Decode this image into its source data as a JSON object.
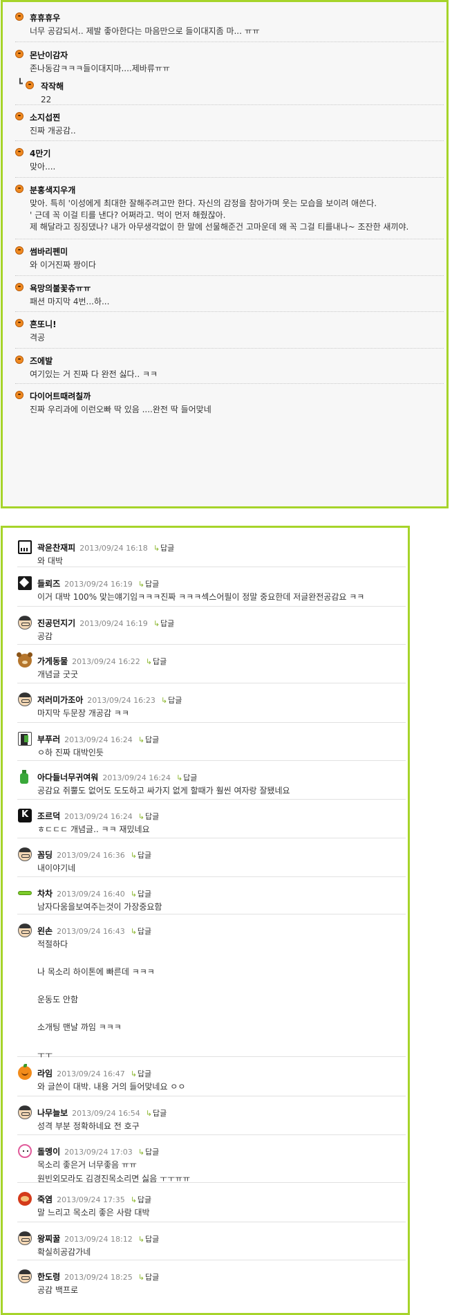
{
  "panel1": {
    "comments": [
      {
        "nick": "휴휴휴우",
        "lines": [
          "너무 공감되서.. 제발 좋아한다는 마음만으로 들이대지좀 마... ㅠㅠ"
        ]
      },
      {
        "nick": "몬난이감자",
        "lines": [
          "존나동감ㅋㅋㅋ들이대지마....제바류ㅠㅠ"
        ],
        "reply": {
          "nick": "작작해",
          "text": "22"
        }
      },
      {
        "nick": "소지섭찐",
        "lines": [
          "진짜 개공감.."
        ]
      },
      {
        "nick": "4만기",
        "lines": [
          "맞아...."
        ]
      },
      {
        "nick": "분홍색지우개",
        "lines": [
          "맞아. 특히 '이성에게 최대한 잘해주려고만 한다. 자신의 감정을 참아가며 웃는 모습을 보이려 애쓴다.",
          "' 근데 꼭 이걸 티를 낸다? 어쩌라고. 먹이 먼저 해줬잖아.",
          "제 해달라고 징징댔나? 내가 아무생각없이 한 말에 선물해준건 고마운데 왜 꼭 그걸 티를내나~ 조잔한 새끼야."
        ]
      },
      {
        "nick": "썸바리펜미",
        "lines": [
          "와 이거진짜 짱이다"
        ]
      },
      {
        "nick": "욕망의불꽃츄ㅠㅠ",
        "lines": [
          "패션 마지막 4번...하..."
        ]
      },
      {
        "nick": "흔또니!",
        "lines": [
          "격공"
        ]
      },
      {
        "nick": "즈에발",
        "lines": [
          "여기있는 거 진짜 다 완전 싫다.. ㅋㅋ"
        ]
      },
      {
        "nick": "다이어트때려칠까",
        "lines": [
          "진짜 우리과에 이런오빠 딱 있음 ....완전 딱 들어맞네"
        ]
      }
    ]
  },
  "panel2": {
    "reply_label": "답글",
    "comments": [
      {
        "nick": "곽윤찬재피",
        "date": "2013/09/24 16:18",
        "avatar": "piano-icon",
        "lines": [
          "와 대박"
        ]
      },
      {
        "nick": "들뢰즈",
        "date": "2013/09/24 16:19",
        "avatar": "bird-icon",
        "lines": [
          "이거 대박 100% 맞는얘기임ㅋㅋㅋ진짜 ㅋㅋㅋ섹스어필이 정말 중요한데 저글완전공감요 ㅋㅋ"
        ]
      },
      {
        "nick": "진공던지기",
        "date": "2013/09/24 16:19",
        "avatar": "glasses-man-icon",
        "lines": [
          "공감"
        ]
      },
      {
        "nick": "가게동물",
        "date": "2013/09/24 16:22",
        "avatar": "bear-icon",
        "lines": [
          "개념글 굿굿"
        ]
      },
      {
        "nick": "저러미가조아",
        "date": "2013/09/24 16:23",
        "avatar": "glasses-man-icon",
        "lines": [
          "마지막 두문장 개공감 ㅋㅋ"
        ]
      },
      {
        "nick": "부푸러",
        "date": "2013/09/24 16:24",
        "avatar": "slim-figure-icon",
        "lines": [
          "ㅇ하 진짜 대박인듯"
        ]
      },
      {
        "nick": "아다들너무귀여워",
        "date": "2013/09/24 16:24",
        "avatar": "bottle-icon",
        "lines": [
          "공감요 쥐뿔도 없어도 도도하고 싸가지 없게 할때가 훨씬 여자랑 잘됐네요"
        ]
      },
      {
        "nick": "조르덕",
        "date": "2013/09/24 16:24",
        "avatar": "k-letter-icon",
        "lines": [
          "ㅎㄷㄷㄷ 개념글.. ㅋㅋ 재밌네요"
        ]
      },
      {
        "nick": "꼼딩",
        "date": "2013/09/24 16:36",
        "avatar": "glasses-man-icon",
        "lines": [
          "내이야기네"
        ]
      },
      {
        "nick": "차차",
        "date": "2013/09/24 16:40",
        "avatar": "green-bar-icon",
        "lines": [
          "남자다움을보여주는것이 가장중요함"
        ]
      },
      {
        "nick": "왼손",
        "date": "2013/09/24 16:43",
        "avatar": "glasses-man-icon",
        "lines": [
          "적절하다",
          "",
          "나 목소리 하이톤에 빠른데 ㅋㅋㅋ",
          "",
          "운동도 안함",
          "",
          "소개팅 맨날 까임 ㅋㅋㅋ",
          "",
          "ㅜㅜ"
        ]
      },
      {
        "nick": "라임",
        "date": "2013/09/24 16:47",
        "avatar": "orange-icon",
        "lines": [
          "와 글쓴이 대박. 내용 거의 들어맞네요 ㅇㅇ"
        ]
      },
      {
        "nick": "나무늘보",
        "date": "2013/09/24 16:54",
        "avatar": "glasses-man-icon",
        "lines": [
          "성격 부분 정확하네요 전 호구"
        ]
      },
      {
        "nick": "돌멩이",
        "date": "2013/09/24 17:03",
        "avatar": "bunny-icon",
        "lines": [
          "목소리 좋은거 너무좋음 ㅠㅠ",
          "원빈외모라도 김경진목소리면 싫음 ㅜㅜㅠㅠ"
        ]
      },
      {
        "nick": "죽염",
        "date": "2013/09/24 17:35",
        "avatar": "red-character-icon",
        "lines": [
          "말 느리고 목소리 좋은 사람 대박"
        ]
      },
      {
        "nick": "왕찌꿀",
        "date": "2013/09/24 18:12",
        "avatar": "glasses-man-icon",
        "lines": [
          "확실히공감가네"
        ]
      },
      {
        "nick": "한도령",
        "date": "2013/09/24 18:25",
        "avatar": "glasses-man-icon",
        "lines": [
          "공감 백프로"
        ]
      }
    ]
  }
}
